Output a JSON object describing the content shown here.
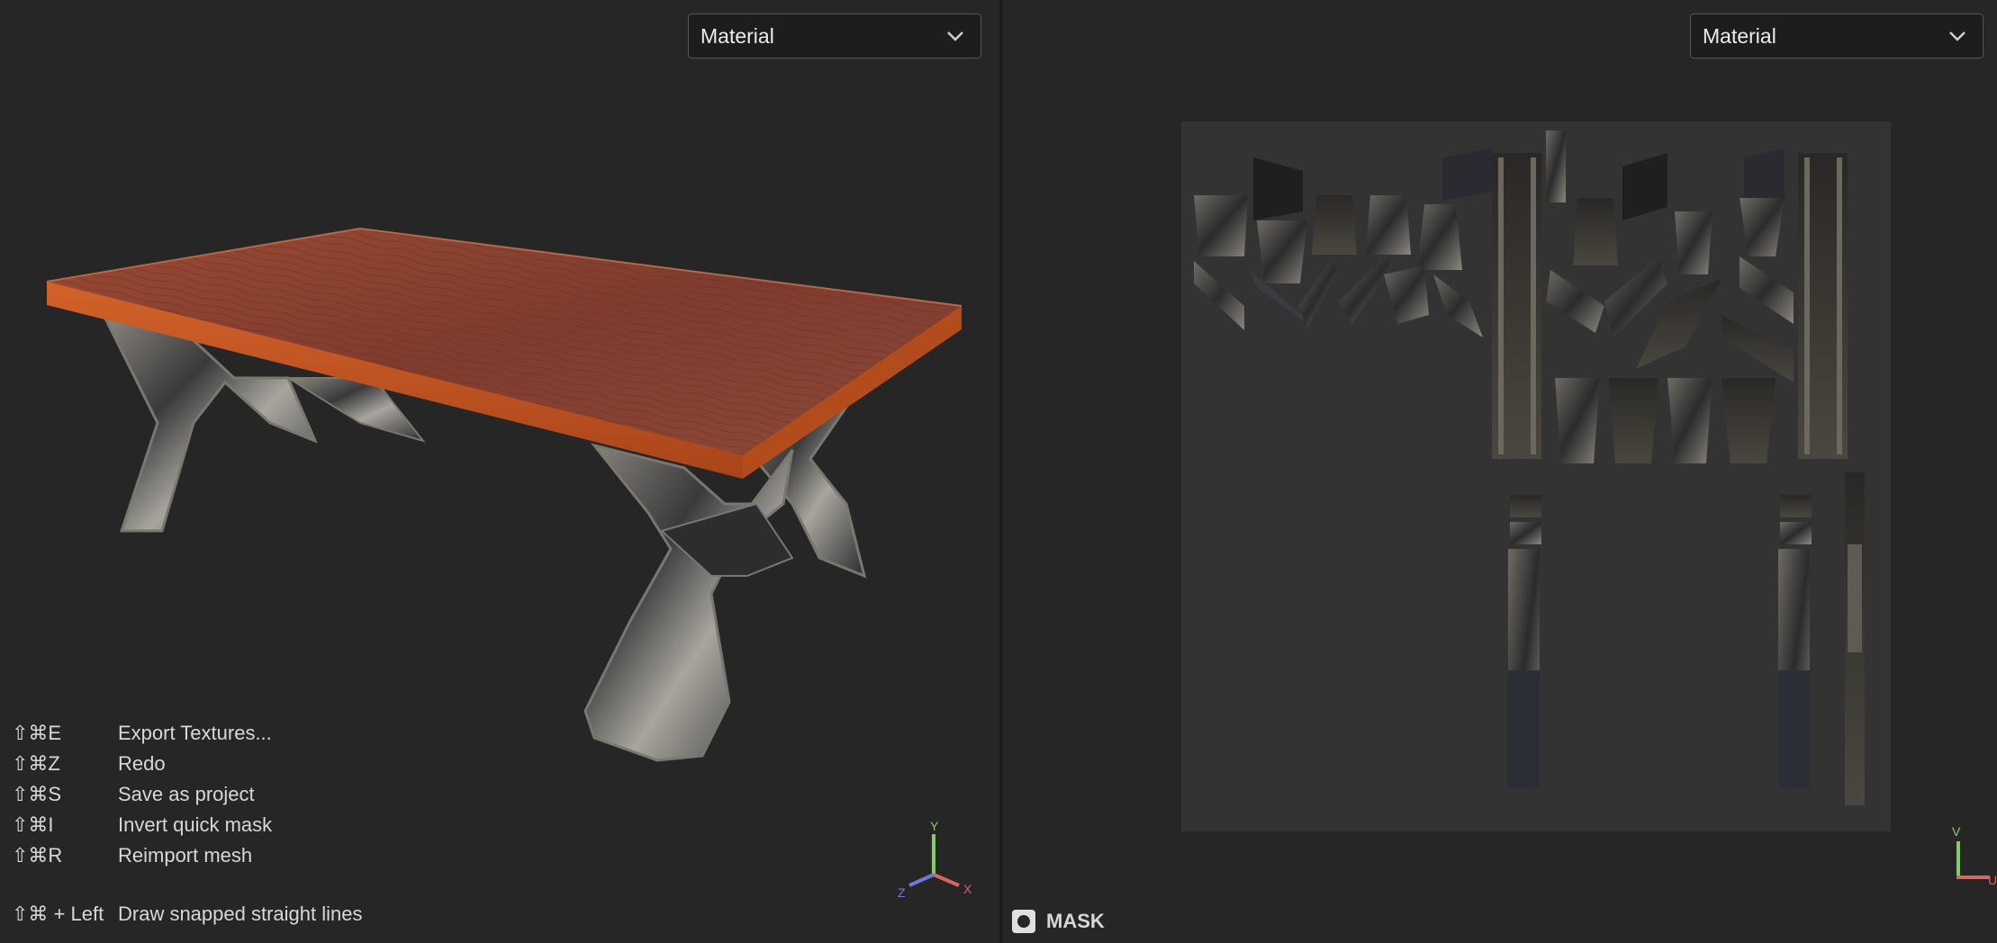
{
  "viewport3d": {
    "material_select": "Material"
  },
  "viewport2d": {
    "material_select": "Material",
    "mask_label": "MASK"
  },
  "shortcuts": [
    {
      "key": "⇧⌘E",
      "action": "Export Textures..."
    },
    {
      "key": "⇧⌘Z",
      "action": "Redo"
    },
    {
      "key": "⇧⌘S",
      "action": "Save as project"
    },
    {
      "key": "⇧⌘I",
      "action": "Invert quick mask"
    },
    {
      "key": "⇧⌘R",
      "action": "Reimport mesh"
    }
  ],
  "extra_shortcut": {
    "key": "⇧⌘ + Left",
    "action": "Draw snapped straight lines"
  },
  "gizmo": {
    "x": "X",
    "y": "Y",
    "z": "Z"
  },
  "uv_axes": {
    "u": "U",
    "v": "V"
  },
  "colors": {
    "wood_top": "#8a3f2c",
    "wood_edge": "#c4571f",
    "metal": "#6e6a63",
    "axis_x": "#d2685f",
    "axis_y": "#7fcf63",
    "axis_z": "#7078d8"
  },
  "icons": [
    "chevron-down-icon",
    "mask-icon",
    "axis-gizmo-icon",
    "uv-axis-icon"
  ]
}
